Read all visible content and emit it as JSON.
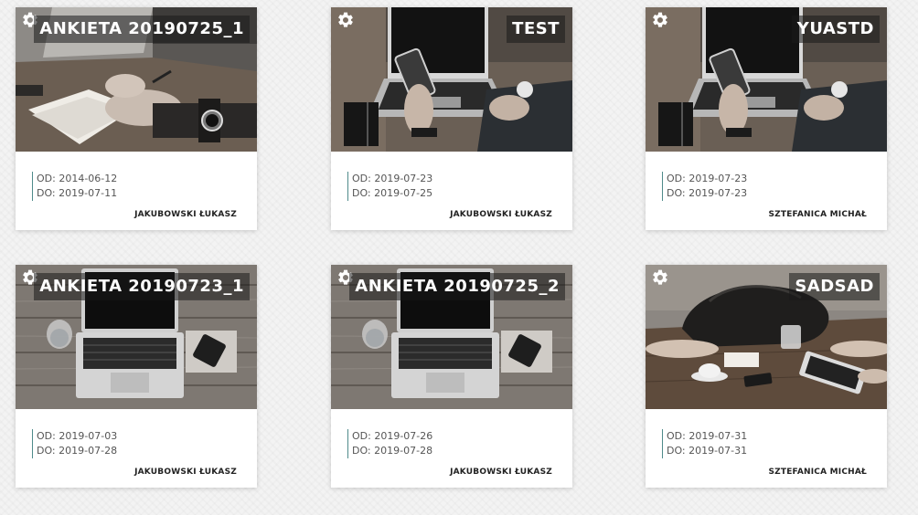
{
  "surveys": [
    {
      "title": "ANKIETA 20190725_1",
      "from": "OD: 2014-06-12",
      "to": "DO: 2019-07-11",
      "owner": "JAKUBOWSKI ŁUKASZ",
      "image": "hand-writing-notebook-photo"
    },
    {
      "title": "TEST",
      "from": "OD: 2019-07-23",
      "to": "DO: 2019-07-25",
      "owner": "JAKUBOWSKI ŁUKASZ",
      "image": "laptop-phone-photo"
    },
    {
      "title": "YUASTD",
      "from": "OD: 2019-07-23",
      "to": "DO: 2019-07-23",
      "owner": "SZTEFANICA MICHAŁ",
      "image": "laptop-phone-photo"
    },
    {
      "title": "ANKIETA 20190723_1",
      "from": "OD: 2019-07-03",
      "to": "DO: 2019-07-28",
      "owner": "JAKUBOWSKI ŁUKASZ",
      "image": "laptop-on-desk-photo"
    },
    {
      "title": "ANKIETA 20190725_2",
      "from": "OD: 2019-07-26",
      "to": "DO: 2019-07-28",
      "owner": "JAKUBOWSKI ŁUKASZ",
      "image": "laptop-on-desk-photo"
    },
    {
      "title": "SADSAD",
      "from": "OD: 2019-07-31",
      "to": "DO: 2019-07-31",
      "owner": "SZTEFANICA MICHAŁ",
      "image": "meeting-table-photo"
    }
  ],
  "icons": {
    "settings": "gear-icon"
  },
  "colors": {
    "accent_line": "#4f8b8b",
    "title_overlay": "#191919",
    "page_background": "#f3f3f3"
  }
}
